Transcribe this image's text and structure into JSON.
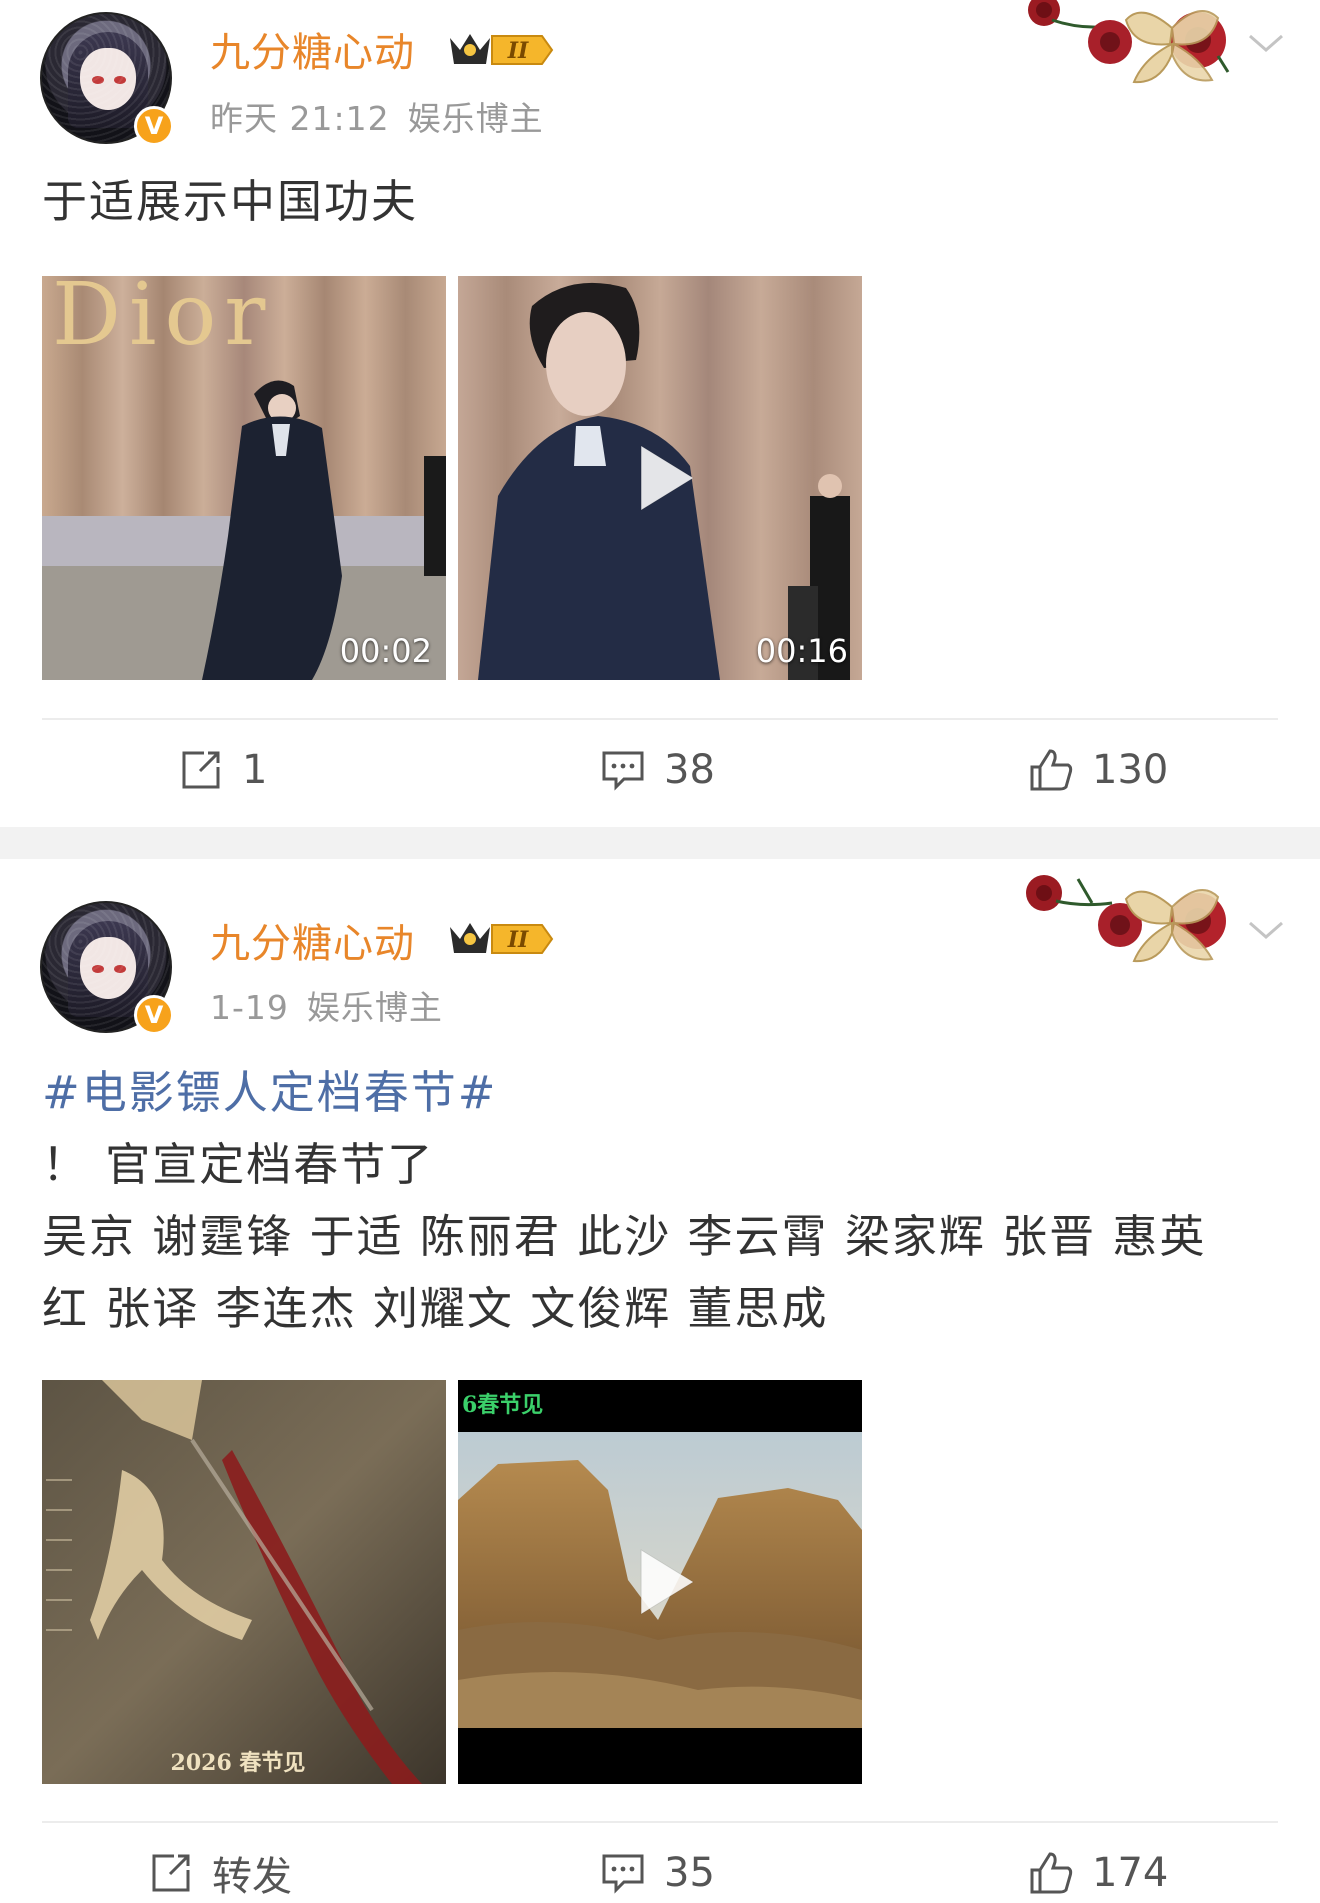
{
  "posts": [
    {
      "author": "九分糖心动",
      "level_badge": "II",
      "time": "昨天 21:12",
      "category": "娱乐博主",
      "verified_badge": "V",
      "text_lines": [
        "于适展示中国功夫"
      ],
      "media": [
        {
          "type": "video",
          "duration": "00:02",
          "description_icon": "play-icon"
        },
        {
          "type": "video",
          "duration": "00:16",
          "description_icon": "play-icon"
        }
      ],
      "actions": {
        "repost": "1",
        "comment": "38",
        "like": "130"
      }
    },
    {
      "author": "九分糖心动",
      "level_badge": "II",
      "time": "1-19",
      "category": "娱乐博主",
      "verified_badge": "V",
      "hashtag": "#电影镖人定档春节#",
      "text_lines": [
        "！ 官宣定档春节了",
        "吴京 谢霆锋 于适 陈丽君 此沙 李云霄 梁家辉 张晋 惠英",
        "红 张译 李连杰 刘耀文  文俊辉 董思成"
      ],
      "media": [
        {
          "type": "image",
          "caption": "2026 春节见"
        },
        {
          "type": "video",
          "caption": "6春节见",
          "description_icon": "play-icon"
        }
      ],
      "actions": {
        "repost": "转发",
        "comment": "35",
        "like": "174"
      }
    }
  ],
  "colors": {
    "username": "#e8862a",
    "hashtag": "#4e6ea6",
    "meta": "#999999",
    "separator": "#f2f2f2"
  }
}
